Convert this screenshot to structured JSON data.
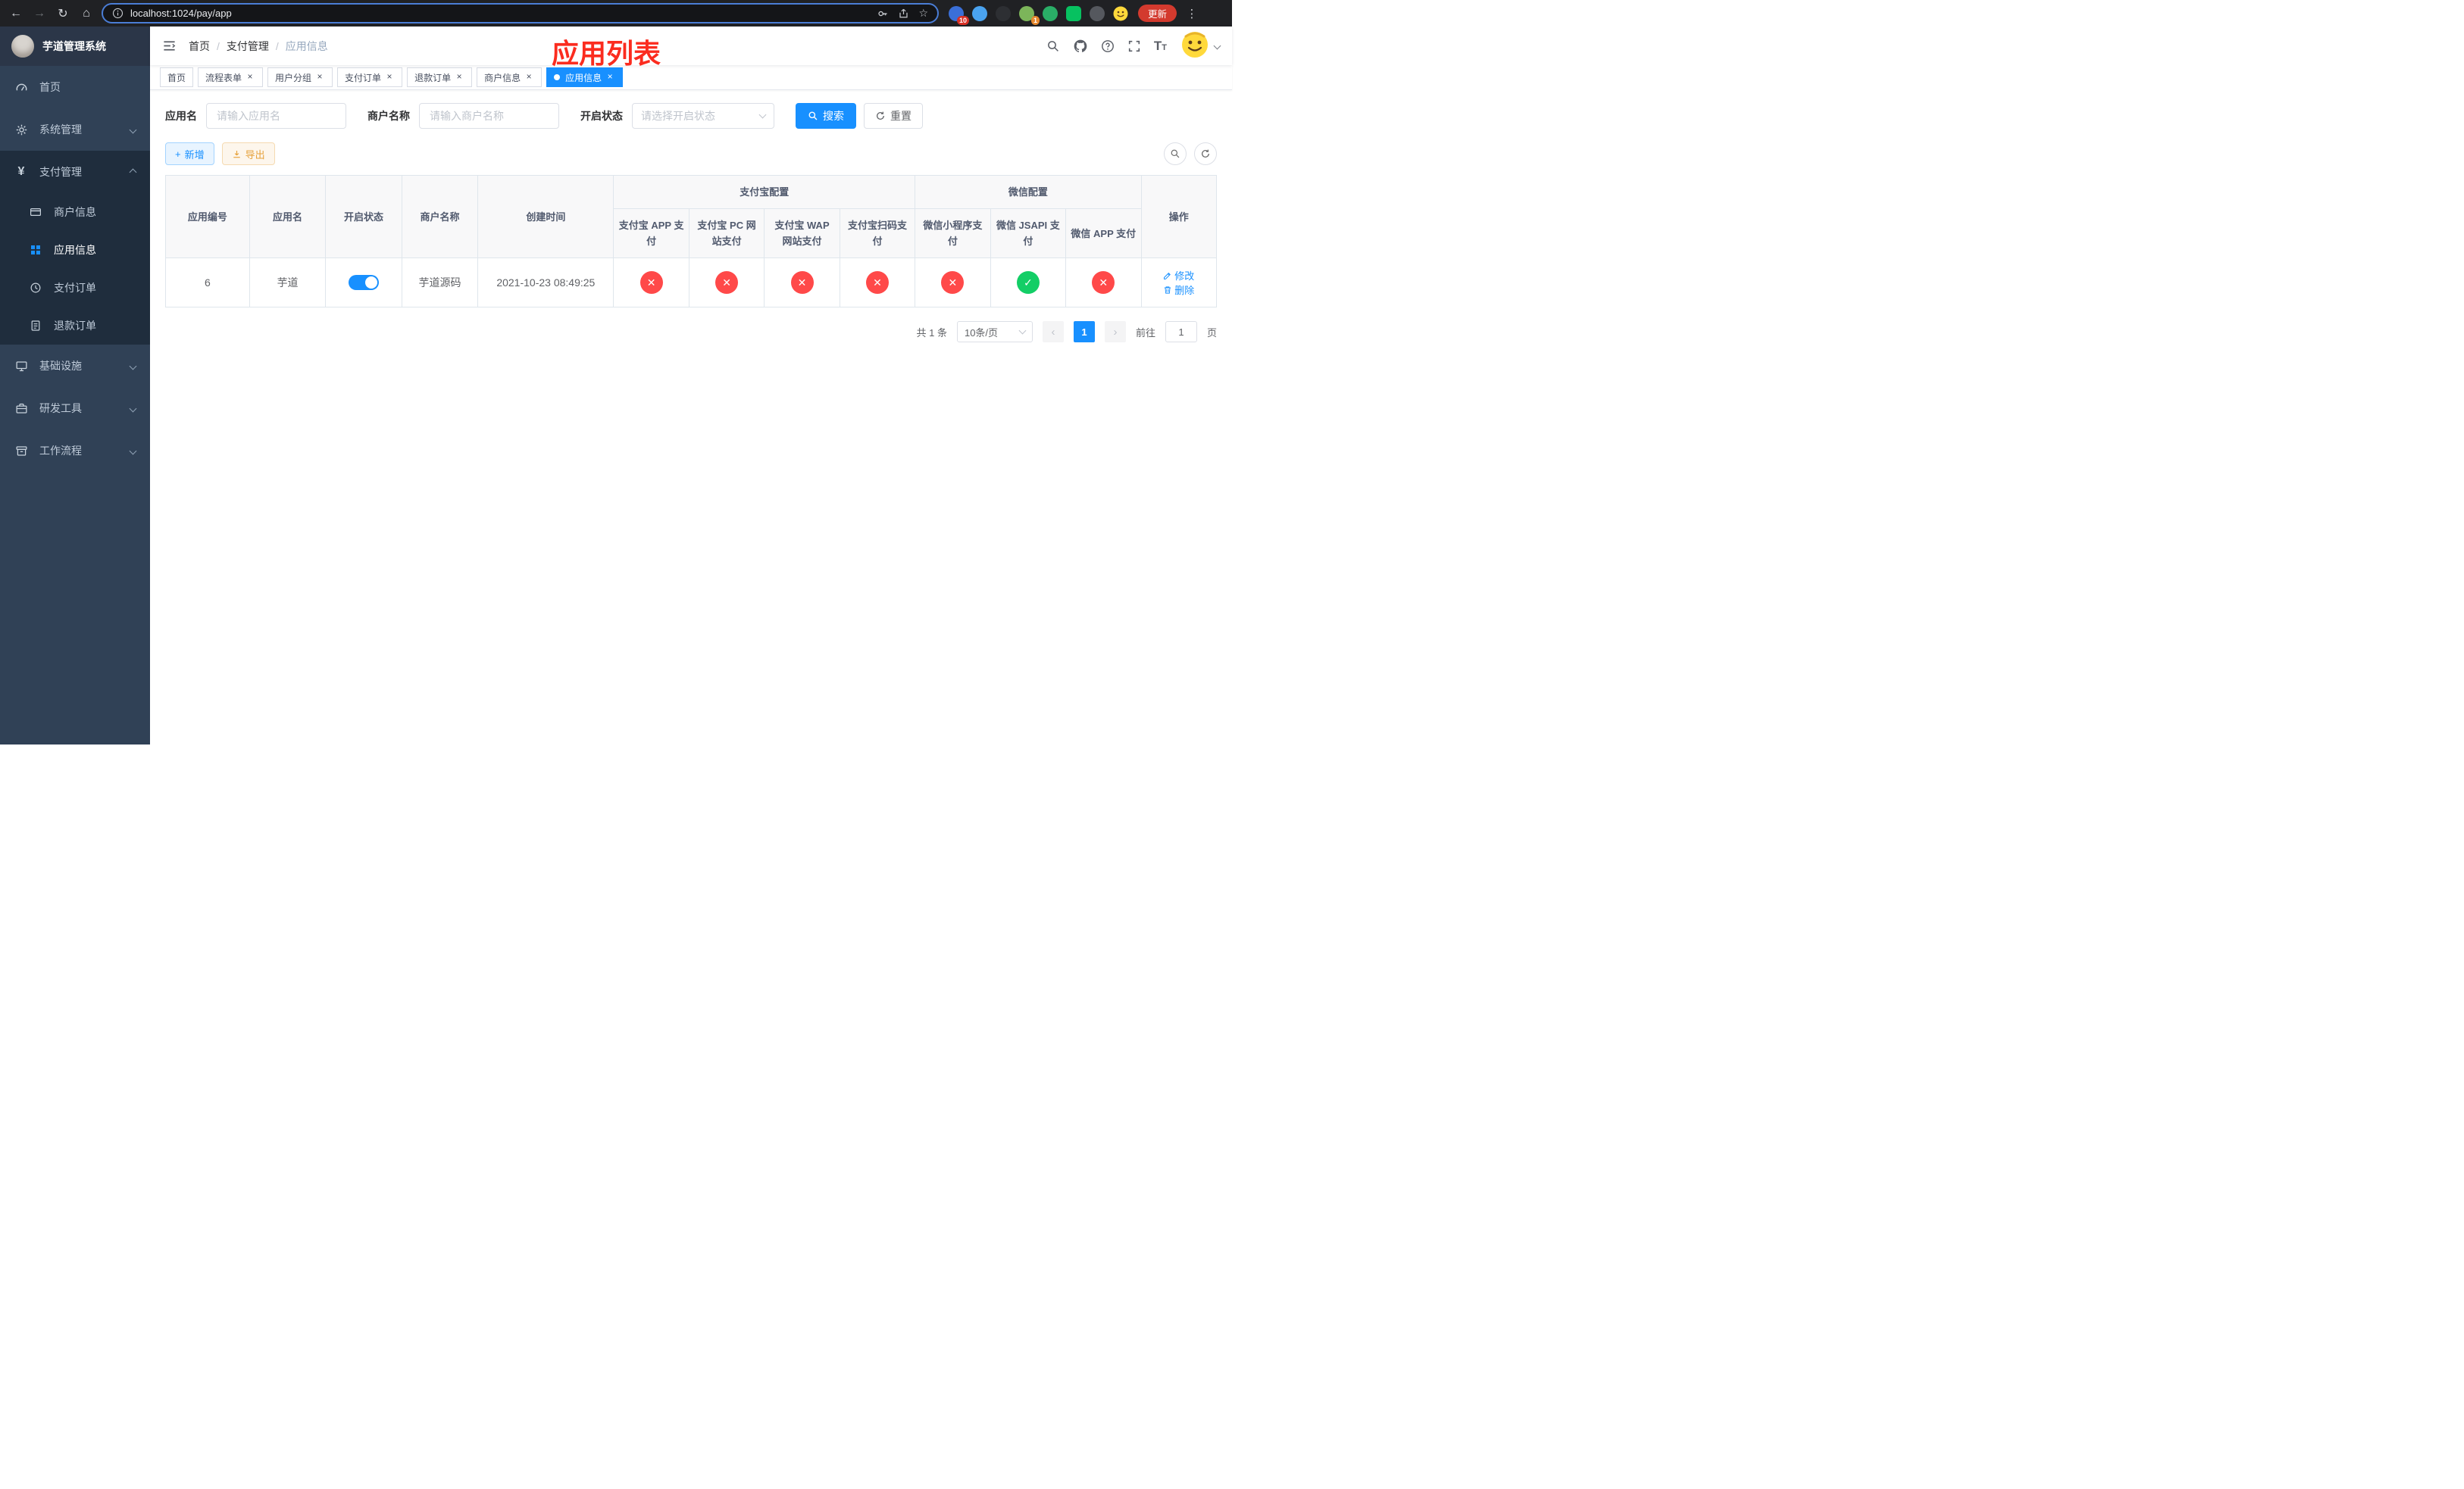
{
  "colors": {
    "primary": "#1890ff",
    "success": "#13ce66",
    "danger": "#ff4949",
    "warning": "#e6a23c",
    "sidebar_bg": "#304156",
    "submenu_bg": "#1f2d3d",
    "annotation_red": "#fb2c1f"
  },
  "icons": {
    "back": "←",
    "forward": "→",
    "reload": "↻",
    "home": "⌂",
    "star": "☆",
    "menu_dots": "⋮",
    "close": "×",
    "prev": "‹",
    "next": "›",
    "plus": "+",
    "yen": "¥",
    "slash": "/",
    "font_size": "T"
  },
  "browser": {
    "url": "localhost:1024/pay/app",
    "update_label": "更新",
    "pin_badge": "10",
    "avatar_badge": "1"
  },
  "sidebar": {
    "logo_title": "芋道管理系统",
    "items": [
      {
        "label": "首页"
      },
      {
        "label": "系统管理"
      },
      {
        "label": "支付管理"
      },
      {
        "label": "基础设施"
      },
      {
        "label": "研发工具"
      },
      {
        "label": "工作流程"
      }
    ],
    "submenu": [
      {
        "label": "商户信息"
      },
      {
        "label": "应用信息"
      },
      {
        "label": "支付订单"
      },
      {
        "label": "退款订单"
      }
    ]
  },
  "header": {
    "breadcrumb": [
      "首页",
      "支付管理",
      "应用信息"
    ],
    "annotation": "应用列表"
  },
  "tabs": [
    {
      "label": "首页"
    },
    {
      "label": "流程表单"
    },
    {
      "label": "用户分组"
    },
    {
      "label": "支付订单"
    },
    {
      "label": "退款订单"
    },
    {
      "label": "商户信息"
    },
    {
      "label": "应用信息"
    }
  ],
  "filters": {
    "app_name_label": "应用名",
    "app_name_placeholder": "请输入应用名",
    "merchant_label": "商户名称",
    "merchant_placeholder": "请输入商户名称",
    "status_label": "开启状态",
    "status_placeholder": "请选择开启状态",
    "search_label": "搜索",
    "reset_label": "重置"
  },
  "toolbar": {
    "add_label": "新增",
    "export_label": "导出"
  },
  "table": {
    "columns": {
      "id": "应用编号",
      "name": "应用名",
      "status": "开启状态",
      "merchant": "商户名称",
      "created": "创建时间",
      "actions": "操作"
    },
    "groups": {
      "alipay": "支付宝配置",
      "wechat": "微信配置"
    },
    "config_columns": [
      "支付宝 APP 支付",
      "支付宝 PC 网站支付",
      "支付宝 WAP 网站支付",
      "支付宝扫码支付",
      "微信小程序支付",
      "微信 JSAPI 支付",
      "微信 APP 支付"
    ],
    "rows": [
      {
        "id": "6",
        "name": "芋道",
        "status": "on",
        "merchant": "芋道源码",
        "created": "2021-10-23 08:49:25",
        "configs": [
          "fail",
          "fail",
          "fail",
          "fail",
          "fail",
          "pass",
          "fail"
        ],
        "edit_label": "修改",
        "delete_label": "删除"
      }
    ]
  },
  "pagination": {
    "total": "共 1 条",
    "page_size": "10条/页",
    "current": "1",
    "goto_label": "前往",
    "goto_value": "1",
    "goto_suffix": "页"
  }
}
